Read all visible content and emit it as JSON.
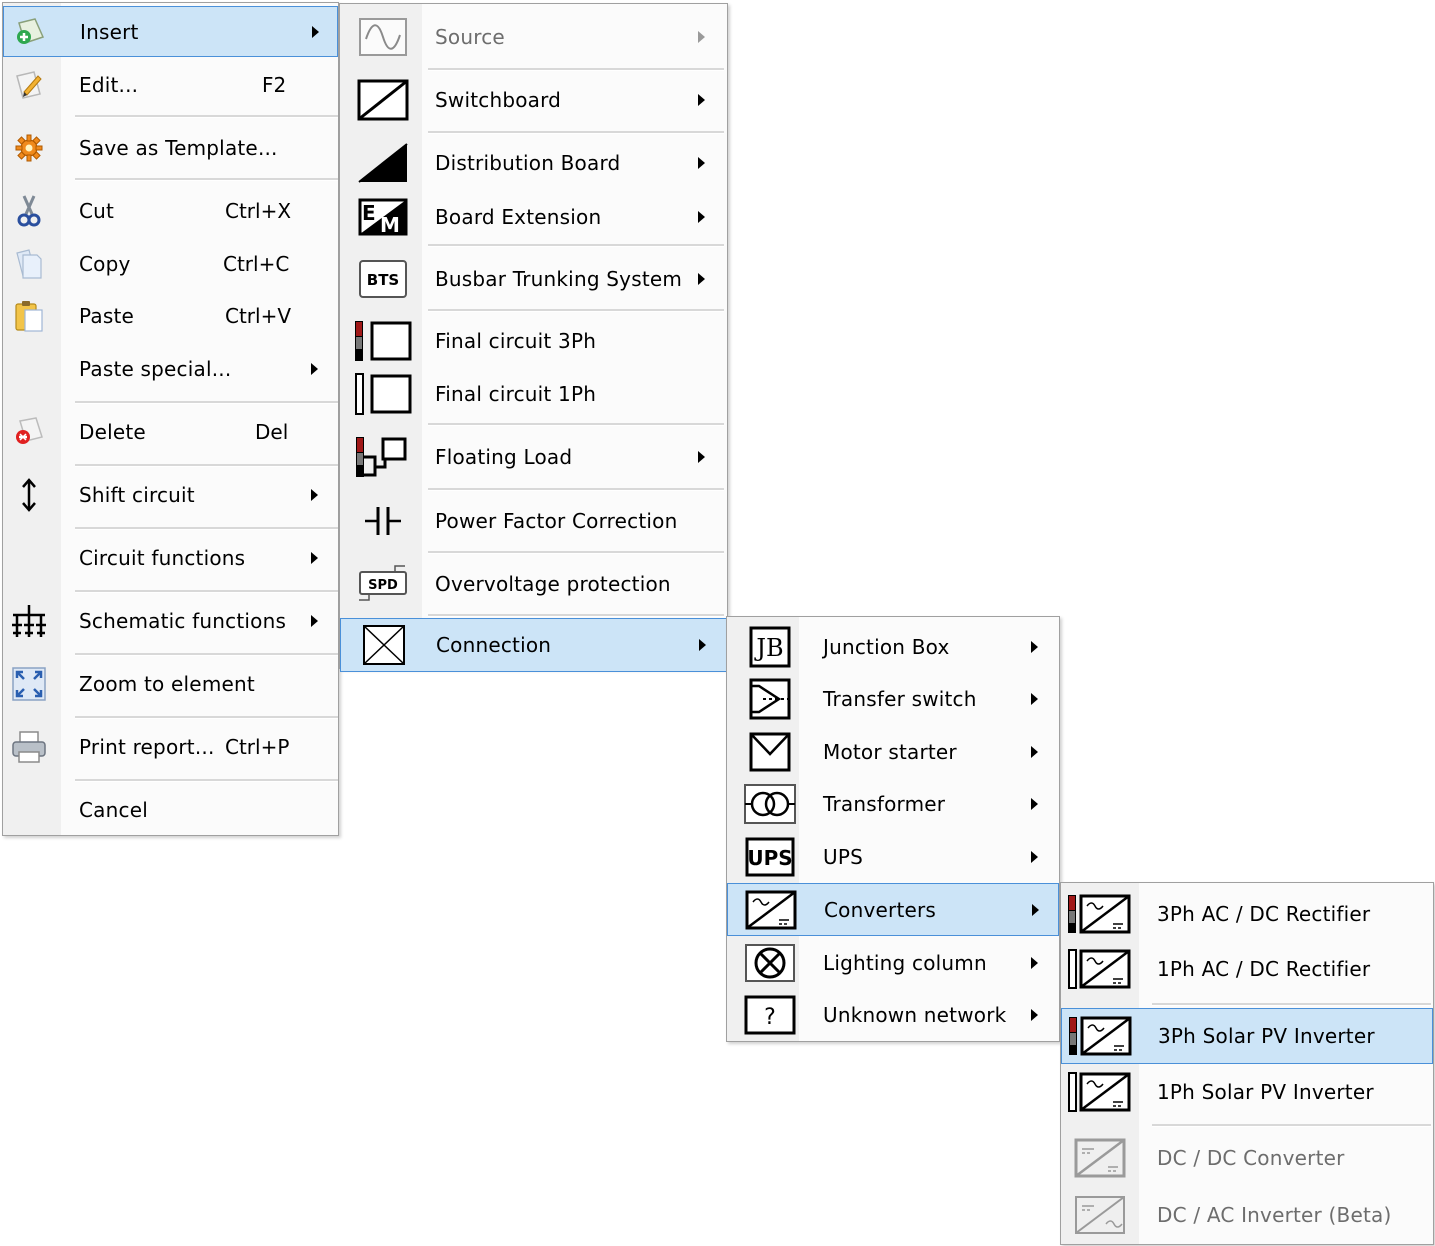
{
  "main_menu": {
    "items": [
      {
        "label": "Insert",
        "shortcut": "",
        "icon": "insert-icon"
      },
      {
        "label": "Edit...",
        "shortcut": "F2",
        "icon": "edit-pencil-icon"
      },
      {
        "label": "Save as Template...",
        "shortcut": "",
        "icon": "template-gear-icon"
      },
      {
        "label": "Cut",
        "shortcut": "Ctrl+X",
        "icon": "scissors-icon"
      },
      {
        "label": "Copy",
        "shortcut": "Ctrl+C",
        "icon": "copy-icon"
      },
      {
        "label": "Paste",
        "shortcut": "Ctrl+V",
        "icon": "paste-icon"
      },
      {
        "label": "Paste special...",
        "shortcut": "",
        "icon": ""
      },
      {
        "label": "Delete",
        "shortcut": "Del",
        "icon": "delete-icon"
      },
      {
        "label": "Shift circuit",
        "shortcut": "",
        "icon": "shift-arrows-icon"
      },
      {
        "label": "Circuit functions",
        "shortcut": "",
        "icon": ""
      },
      {
        "label": "Schematic functions",
        "shortcut": "",
        "icon": "schematic-icon"
      },
      {
        "label": "Zoom to element",
        "shortcut": "",
        "icon": "zoom-fit-icon"
      },
      {
        "label": "Print report...",
        "shortcut": "Ctrl+P",
        "icon": "printer-icon"
      },
      {
        "label": "Cancel",
        "shortcut": "",
        "icon": ""
      }
    ]
  },
  "insert_menu": {
    "items": [
      {
        "label": "Source",
        "icon": "source-sine-icon",
        "disabled": true
      },
      {
        "label": "Switchboard",
        "icon": "switchboard-icon"
      },
      {
        "label": "Distribution Board",
        "icon": "distribution-board-icon"
      },
      {
        "label": "Board Extension",
        "icon": "board-extension-icon",
        "icon_text": "EM"
      },
      {
        "label": "Busbar Trunking System",
        "icon": "busbar-icon",
        "icon_text": "BTS"
      },
      {
        "label": "Final circuit 3Ph",
        "icon": "final-circuit-3ph-icon"
      },
      {
        "label": "Final circuit 1Ph",
        "icon": "final-circuit-1ph-icon"
      },
      {
        "label": "Floating Load",
        "icon": "floating-load-icon"
      },
      {
        "label": "Power Factor Correction",
        "icon": "capacitor-icon"
      },
      {
        "label": "Overvoltage protection",
        "icon": "spd-icon",
        "icon_text": "SPD"
      },
      {
        "label": "Connection",
        "icon": "connection-icon"
      }
    ]
  },
  "connection_menu": {
    "items": [
      {
        "label": "Junction Box",
        "icon": "junction-box-icon",
        "icon_text": "JB"
      },
      {
        "label": "Transfer switch",
        "icon": "transfer-switch-icon"
      },
      {
        "label": "Motor starter",
        "icon": "motor-starter-icon"
      },
      {
        "label": "Transformer",
        "icon": "transformer-icon"
      },
      {
        "label": "UPS",
        "icon": "ups-icon",
        "icon_text": "UPS"
      },
      {
        "label": "Converters",
        "icon": "converter-icon"
      },
      {
        "label": "Lighting column",
        "icon": "lighting-column-icon"
      },
      {
        "label": "Unknown network",
        "icon": "unknown-network-icon",
        "icon_text": "?"
      }
    ]
  },
  "converters_menu": {
    "items": [
      {
        "label": "3Ph AC / DC Rectifier",
        "icon": "rectifier-3ph-icon"
      },
      {
        "label": "1Ph AC / DC Rectifier",
        "icon": "rectifier-1ph-icon"
      },
      {
        "label": "3Ph Solar PV Inverter",
        "icon": "pv-inverter-3ph-icon"
      },
      {
        "label": "1Ph Solar PV Inverter",
        "icon": "pv-inverter-1ph-icon"
      },
      {
        "label": "DC / DC Converter",
        "icon": "dc-dc-converter-icon",
        "disabled": true
      },
      {
        "label": "DC / AC Inverter (Beta)",
        "icon": "dc-ac-inverter-icon",
        "disabled": true
      }
    ]
  },
  "colors": {
    "highlight_bg": "#cce4f7",
    "highlight_border": "#4a90d9",
    "menu_bg": "#fbfbfb",
    "gutter_bg": "#f0f0f0",
    "disabled_text": "#6d6d6d",
    "phase_red": "#a01818"
  }
}
